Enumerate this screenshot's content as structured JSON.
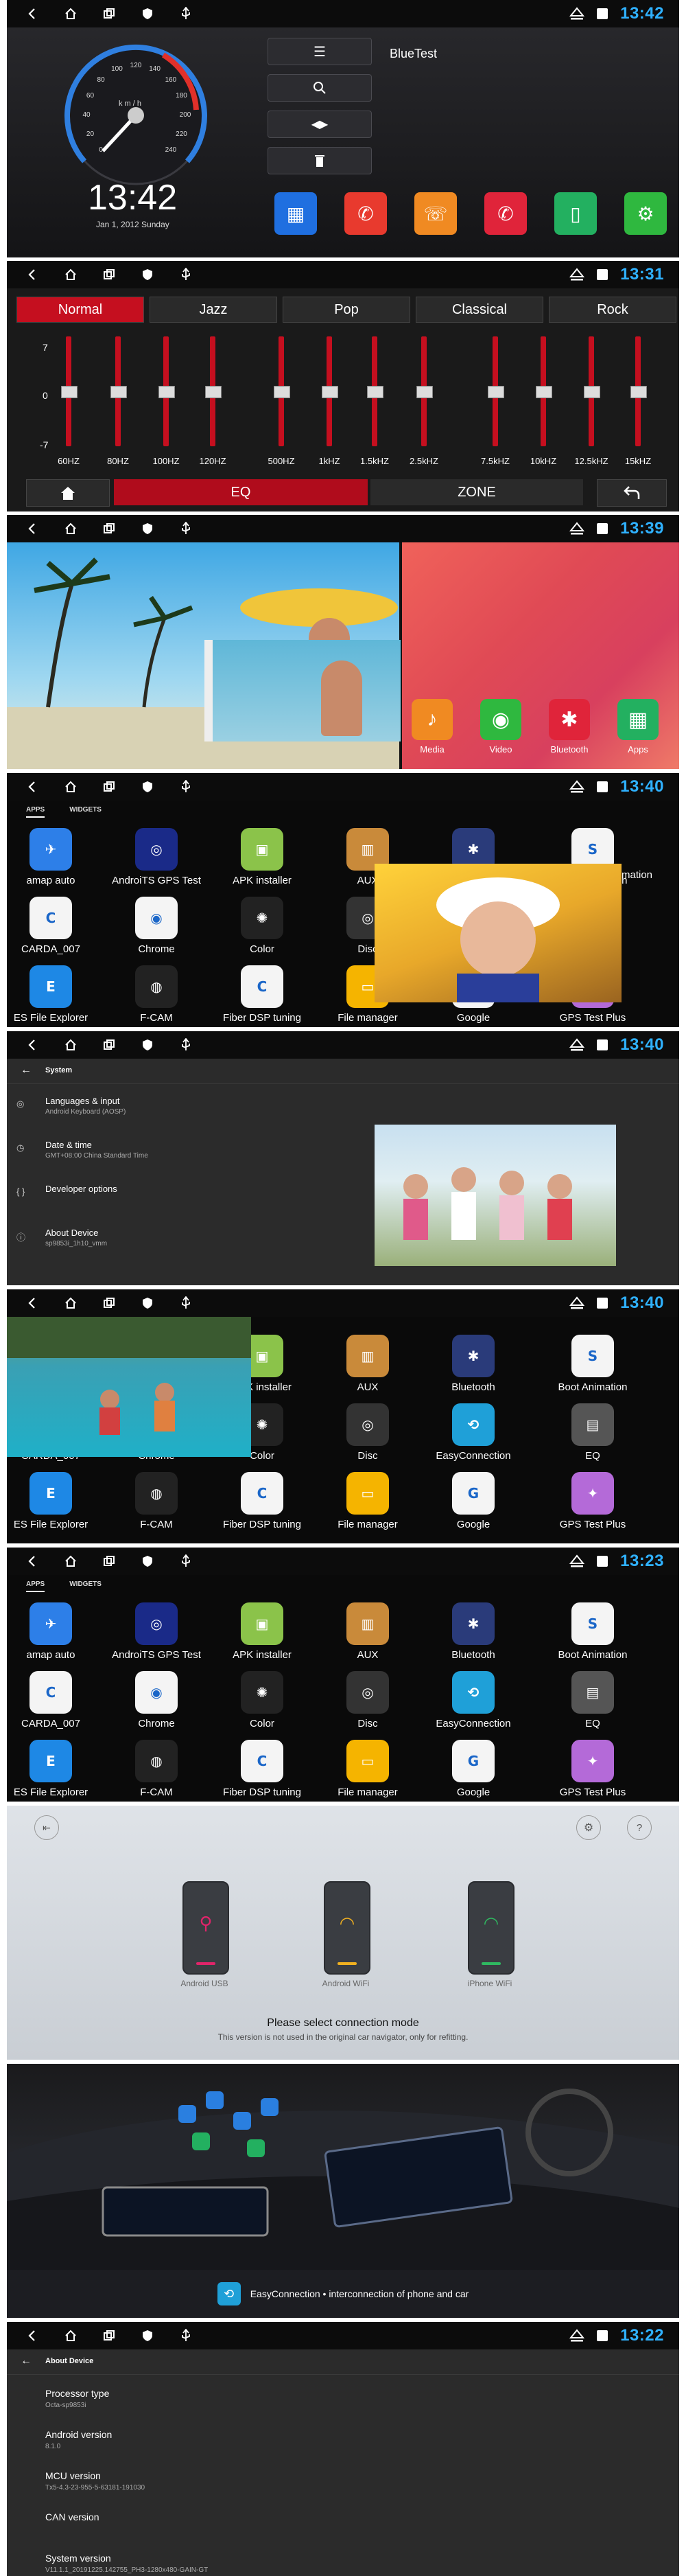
{
  "status": {
    "times": [
      "13:42",
      "13:31",
      "13:39",
      "13:40",
      "13:40",
      "13:40",
      "13:23",
      "13:22"
    ]
  },
  "home": {
    "clock_time": "13:42",
    "clock_date": "Jan 1, 2012  Sunday",
    "bt_name": "BlueTest",
    "speed_unit": "k m / h",
    "speed_ticks": [
      "0",
      "20",
      "40",
      "60",
      "80",
      "100",
      "120",
      "140",
      "160",
      "180",
      "200",
      "220",
      "240"
    ],
    "app_colors": [
      "#1f6fe0",
      "#e83a2e",
      "#f08a22",
      "#e0243a",
      "#23b060",
      "#2fb83f"
    ]
  },
  "eq": {
    "presets": [
      "Normal",
      "Jazz",
      "Pop",
      "Classical",
      "Rock"
    ],
    "scale": [
      "7",
      "0",
      "-7"
    ],
    "bands": [
      "60HZ",
      "80HZ",
      "100HZ",
      "120HZ",
      "500HZ",
      "1kHZ",
      "1.5kHZ",
      "2.5kHZ",
      "7.5kHZ",
      "10kHZ",
      "12.5kHZ",
      "15kHZ"
    ],
    "levels": [
      0,
      0,
      0,
      0,
      0,
      0,
      0,
      0,
      0,
      0,
      0,
      0
    ],
    "eq_label": "EQ",
    "zone_label": "ZONE"
  },
  "launcher": {
    "dock": [
      {
        "label": "Media",
        "color": "#f08a22"
      },
      {
        "label": "Video",
        "color": "#2fb83f"
      },
      {
        "label": "Bluetooth",
        "color": "#e0243a"
      },
      {
        "label": "Apps",
        "color": "#23b060"
      }
    ]
  },
  "apps_tabs": {
    "apps": "APPS",
    "widgets": "WIDGETS"
  },
  "apps": [
    {
      "label": "amap auto",
      "color": "#2d7fe8",
      "glyph": "✈"
    },
    {
      "label": "AndroiTS GPS Test",
      "color": "#1a2a88",
      "glyph": "◎"
    },
    {
      "label": "APK installer",
      "color": "#8bc34a",
      "glyph": "▣"
    },
    {
      "label": "AUX",
      "color": "#c98a3a",
      "glyph": "▥"
    },
    {
      "label": "Bluetooth",
      "color": "#2a3b7a",
      "glyph": "✱"
    },
    {
      "label": "Boot Animation",
      "color": "#f4f4f4",
      "glyph": "S"
    },
    {
      "label": "CARDA_007",
      "color": "#f4f4f4",
      "glyph": "C"
    },
    {
      "label": "Chrome",
      "color": "#f4f4f4",
      "glyph": "◉"
    },
    {
      "label": "Color",
      "color": "#222",
      "glyph": "✺"
    },
    {
      "label": "Disc",
      "color": "#333",
      "glyph": "◎"
    },
    {
      "label": "EasyConnection",
      "color": "#1fa0d8",
      "glyph": "⟲"
    },
    {
      "label": "EQ",
      "color": "#555",
      "glyph": "▤"
    },
    {
      "label": "ES File Explorer",
      "color": "#1e88e5",
      "glyph": "E"
    },
    {
      "label": "F-CAM",
      "color": "#222",
      "glyph": "◍"
    },
    {
      "label": "Fiber DSP tuning",
      "color": "#f4f4f4",
      "glyph": "C"
    },
    {
      "label": "File manager",
      "color": "#f5b400",
      "glyph": "▭"
    },
    {
      "label": "Google",
      "color": "#f4f4f4",
      "glyph": "G"
    },
    {
      "label": "GPS Test Plus",
      "color": "#b46ad8",
      "glyph": "✦"
    }
  ],
  "overlap_label": "mation",
  "system": {
    "header": "System",
    "items": [
      {
        "title": "Languages & input",
        "sub": "Android Keyboard (AOSP)"
      },
      {
        "title": "Date & time",
        "sub": "GMT+08:00 China Standard Time"
      },
      {
        "title": "Developer options",
        "sub": ""
      },
      {
        "title": "About Device",
        "sub": "sp9853i_1h10_vmm"
      }
    ]
  },
  "easy": {
    "modes": [
      "Android USB",
      "Android WiFi",
      "iPhone WiFi"
    ],
    "prompt": "Please select connection mode",
    "note": "This version is not used in the original car navigator, only for refitting.",
    "banner": "EasyConnection • interconnection of phone and car"
  },
  "about": {
    "header": "About Device",
    "items": [
      {
        "title": "Processor type",
        "value": "Octa-sp9853i"
      },
      {
        "title": "Android version",
        "value": "8.1.0"
      },
      {
        "title": "MCU version",
        "value": "Tx5-4.3-23-955-5-63181-191030"
      },
      {
        "title": "CAN version",
        "value": ""
      },
      {
        "title": "System version",
        "value": "V11.1.1_20191225.142755_PH3-1280x480-GAIN-GT"
      }
    ]
  }
}
